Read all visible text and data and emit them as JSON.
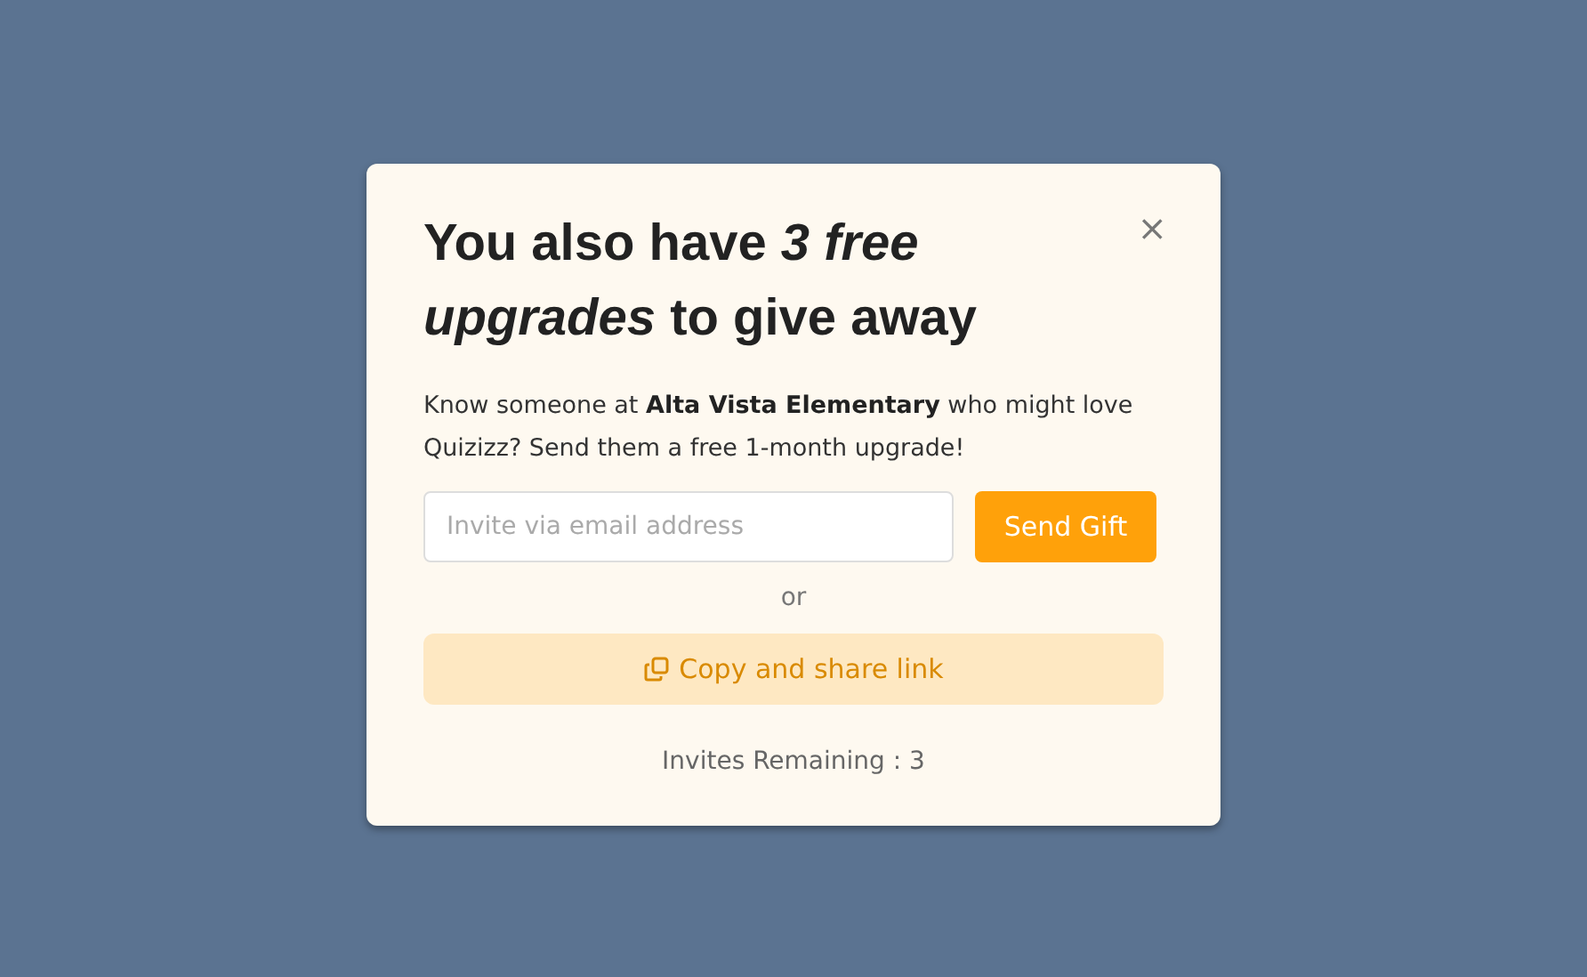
{
  "dialog": {
    "title": "You also have *3 free upgrades* to give away",
    "close": "×",
    "message": "Know someone at **Alta Vista Elementary** who might love Quizizz? Send them a free 1-month upgrade!",
    "email_field": {
      "placeholder": "Invite via email address"
    },
    "send_button": "Send Gift",
    "separator": "or",
    "copy_button": "Copy and share link",
    "footer": "Invites Remaining : 3"
  }
}
